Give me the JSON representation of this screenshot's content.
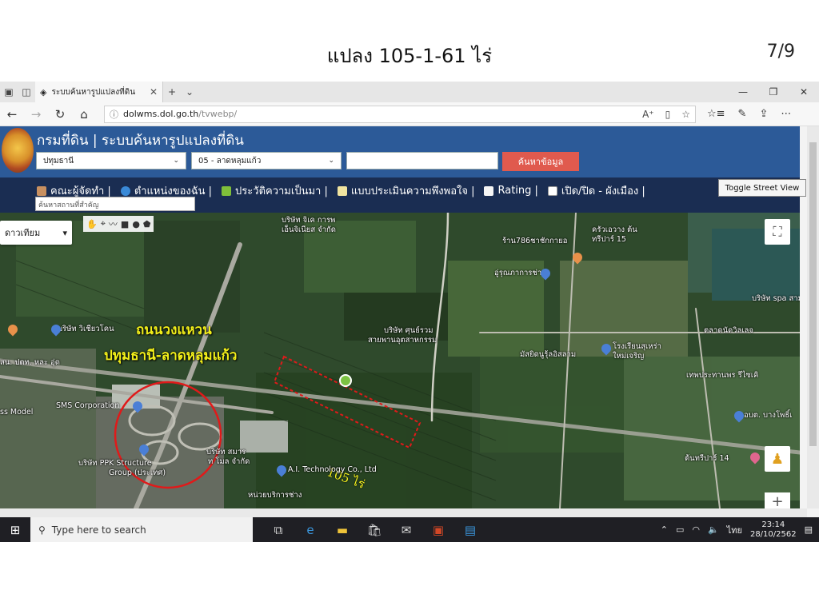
{
  "slide": {
    "title": "แปลง 105-1-61 ไร่",
    "page": "7/9"
  },
  "browser": {
    "tab_title": "ระบบค้นหารูปแปลงที่ดิน",
    "url_domain": "dolwms.dol.go.th",
    "url_path": "/tvwebp/"
  },
  "site": {
    "title": "กรมที่ดิน | ระบบค้นหารูปแปลงที่ดิน",
    "province": "ปทุมธานี",
    "district": "05 - ลาดหลุมแก้ว",
    "search_button": "ค้นหาข้อมูล",
    "place_placeholder": "ค้นหาสถานที่สำคัญ",
    "street_view_button": "Toggle Street View",
    "menu": [
      "คณะผู้จัดทำ |",
      "ตำแหน่งของฉัน |",
      "ประวัติความเป็นมา |",
      "แบบประเมินความพึงพอใจ |",
      "Rating |",
      "เปิด/ปิด - ผังเมือง |"
    ]
  },
  "map": {
    "map_type": "ดาวเทียม",
    "road_label_1": "ถนนวงแหวน",
    "road_label_2": "ปทุมธานี-ลาดหลุมแก้ว",
    "plot_label": "105 ไร่",
    "places": [
      "บริษัท จิเค การพ",
      "เอ็นจิเนียส จำกัด",
      "ร้าน786ชาชักกายอ",
      "อู่รุณภาการช่าง",
      "ครัวเอวาง ต้น",
      "ทรีปาร์ 15",
      "บริษัท spa สามไ",
      "บริษัท วิเชียวโคน",
      "ตลาดนัดวิลเลจ",
      "บริษัท ศุนย์รวม",
      "สายพานอุตสาหกรรม",
      "มัสยิดนูรุ้ลอิสลาม",
      "โรงเรียนสุเหร่า",
      "ใหม่เจริญ",
      "เทพประทานพร รีไซเคิ",
      "SMS Corporation",
      "ss Model",
      "บริษัท PPK Structure",
      "Group (ประเทศ)",
      "บริษัท สมาร",
      "ท โมล จำกัด",
      "A.I. Technology Co., Ltd",
      "หน่วยบริการช่าง",
      "อบต. บางโพธิ์เ",
      "ต้นทรีปาร์ 14",
      "สน. ปตท. หละ อุ่ด"
    ]
  },
  "taskbar": {
    "search_placeholder": "Type here to search",
    "language": "ไทย",
    "time": "23:14",
    "date": "28/10/2562"
  }
}
